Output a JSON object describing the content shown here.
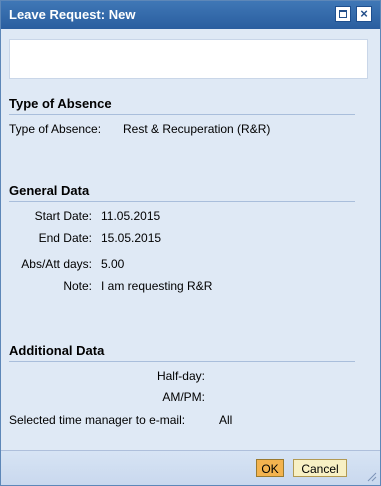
{
  "window": {
    "title": "Leave Request: New"
  },
  "sections": {
    "type_of_absence": {
      "heading": "Type of Absence",
      "label": "Type of Absence:",
      "value": "Rest & Recuperation (R&R)"
    },
    "general_data": {
      "heading": "General Data",
      "start_date_label": "Start Date:",
      "start_date_value": "11.05.2015",
      "end_date_label": "End Date:",
      "end_date_value": "15.05.2015",
      "abs_att_label": "Abs/Att days:",
      "abs_att_value": "5.00",
      "note_label": "Note:",
      "note_value": "I am requesting R&R"
    },
    "additional_data": {
      "heading": "Additional Data",
      "half_day_label": "Half-day:",
      "ampm_label": "AM/PM:",
      "time_manager_label": "Selected time manager to e-mail:",
      "time_manager_value": "All"
    }
  },
  "footer": {
    "ok_label": "OK",
    "cancel_label": "Cancel"
  },
  "colors": {
    "title_bar": "#2f67aa",
    "body": "#dfe9f5",
    "ok_button": "#f3b34f",
    "cancel_button": "#f8f0c4"
  }
}
